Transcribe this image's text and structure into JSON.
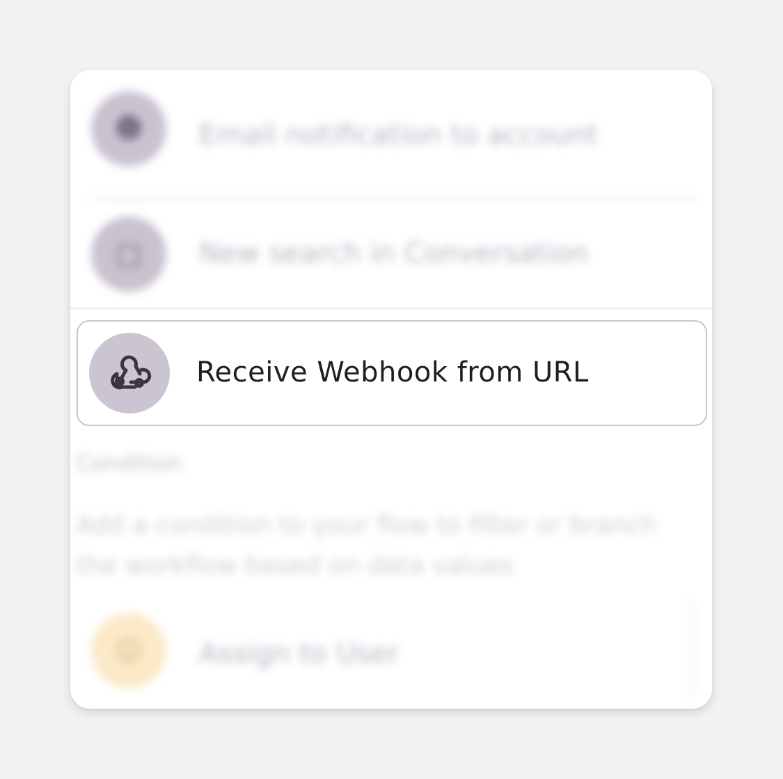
{
  "colors": {
    "page_background": "#f3f2f0",
    "card_background": "#ffffff",
    "avatar_purple": "#cbc5d1",
    "avatar_yellow": "#fbe9c8",
    "focus_border": "#c8c4cd",
    "text_primary": "#1f1f22"
  },
  "blurred_items": [
    {
      "icon": "user-icon",
      "label": "Email notification to account"
    },
    {
      "icon": "document-icon",
      "label": "New search in Conversation"
    }
  ],
  "focused_item": {
    "icon": "webhook-icon",
    "label": "Receive Webhook from URL"
  },
  "section": {
    "title": "Condition",
    "description": "Add a condition to your flow to filter or branch the workflow based on data values"
  },
  "bottom_item": {
    "icon": "user-icon",
    "label": "Assign to User"
  }
}
